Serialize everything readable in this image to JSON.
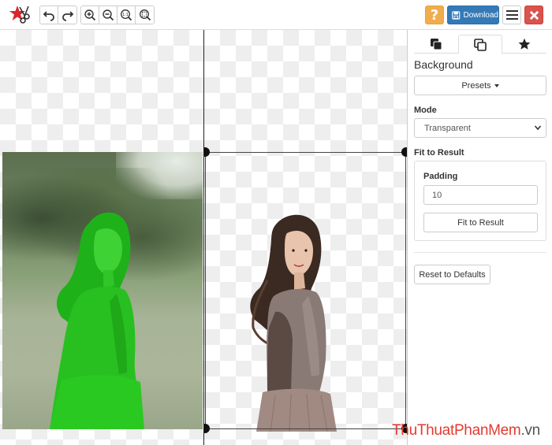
{
  "toolbar": {
    "logo_icon": "scissors-star-logo",
    "history_icons": [
      "undo-icon",
      "redo-icon"
    ],
    "zoom_icons": [
      "zoom-in-icon",
      "zoom-out-icon",
      "zoom-actual-size-icon",
      "zoom-fit-icon"
    ],
    "help_label": "?",
    "download_label": "Download",
    "colors": {
      "help": "#f0ad4e",
      "download": "#337ab7",
      "close": "#d9534f"
    }
  },
  "canvas": {
    "left_view": "original-photo-with-green-keep-mask",
    "right_view": "cutout-on-transparent",
    "mask_color": "#22c51a"
  },
  "panel": {
    "tabs": [
      {
        "icon": "layers-icon",
        "active": false
      },
      {
        "icon": "copy-icon",
        "active": true
      },
      {
        "icon": "star-icon",
        "active": false
      }
    ],
    "background_title": "Background",
    "presets_label": "Presets",
    "mode_label": "Mode",
    "mode_value": "Transparent",
    "fit_title": "Fit to Result",
    "padding_label": "Padding",
    "padding_value": "10",
    "fit_button": "Fit to Result",
    "reset_button": "Reset to Defaults"
  },
  "watermark": {
    "part1": "Thu",
    "part2": "Thuat",
    "part3": "Phan",
    "part4": "Mem",
    "part5": ".vn"
  }
}
